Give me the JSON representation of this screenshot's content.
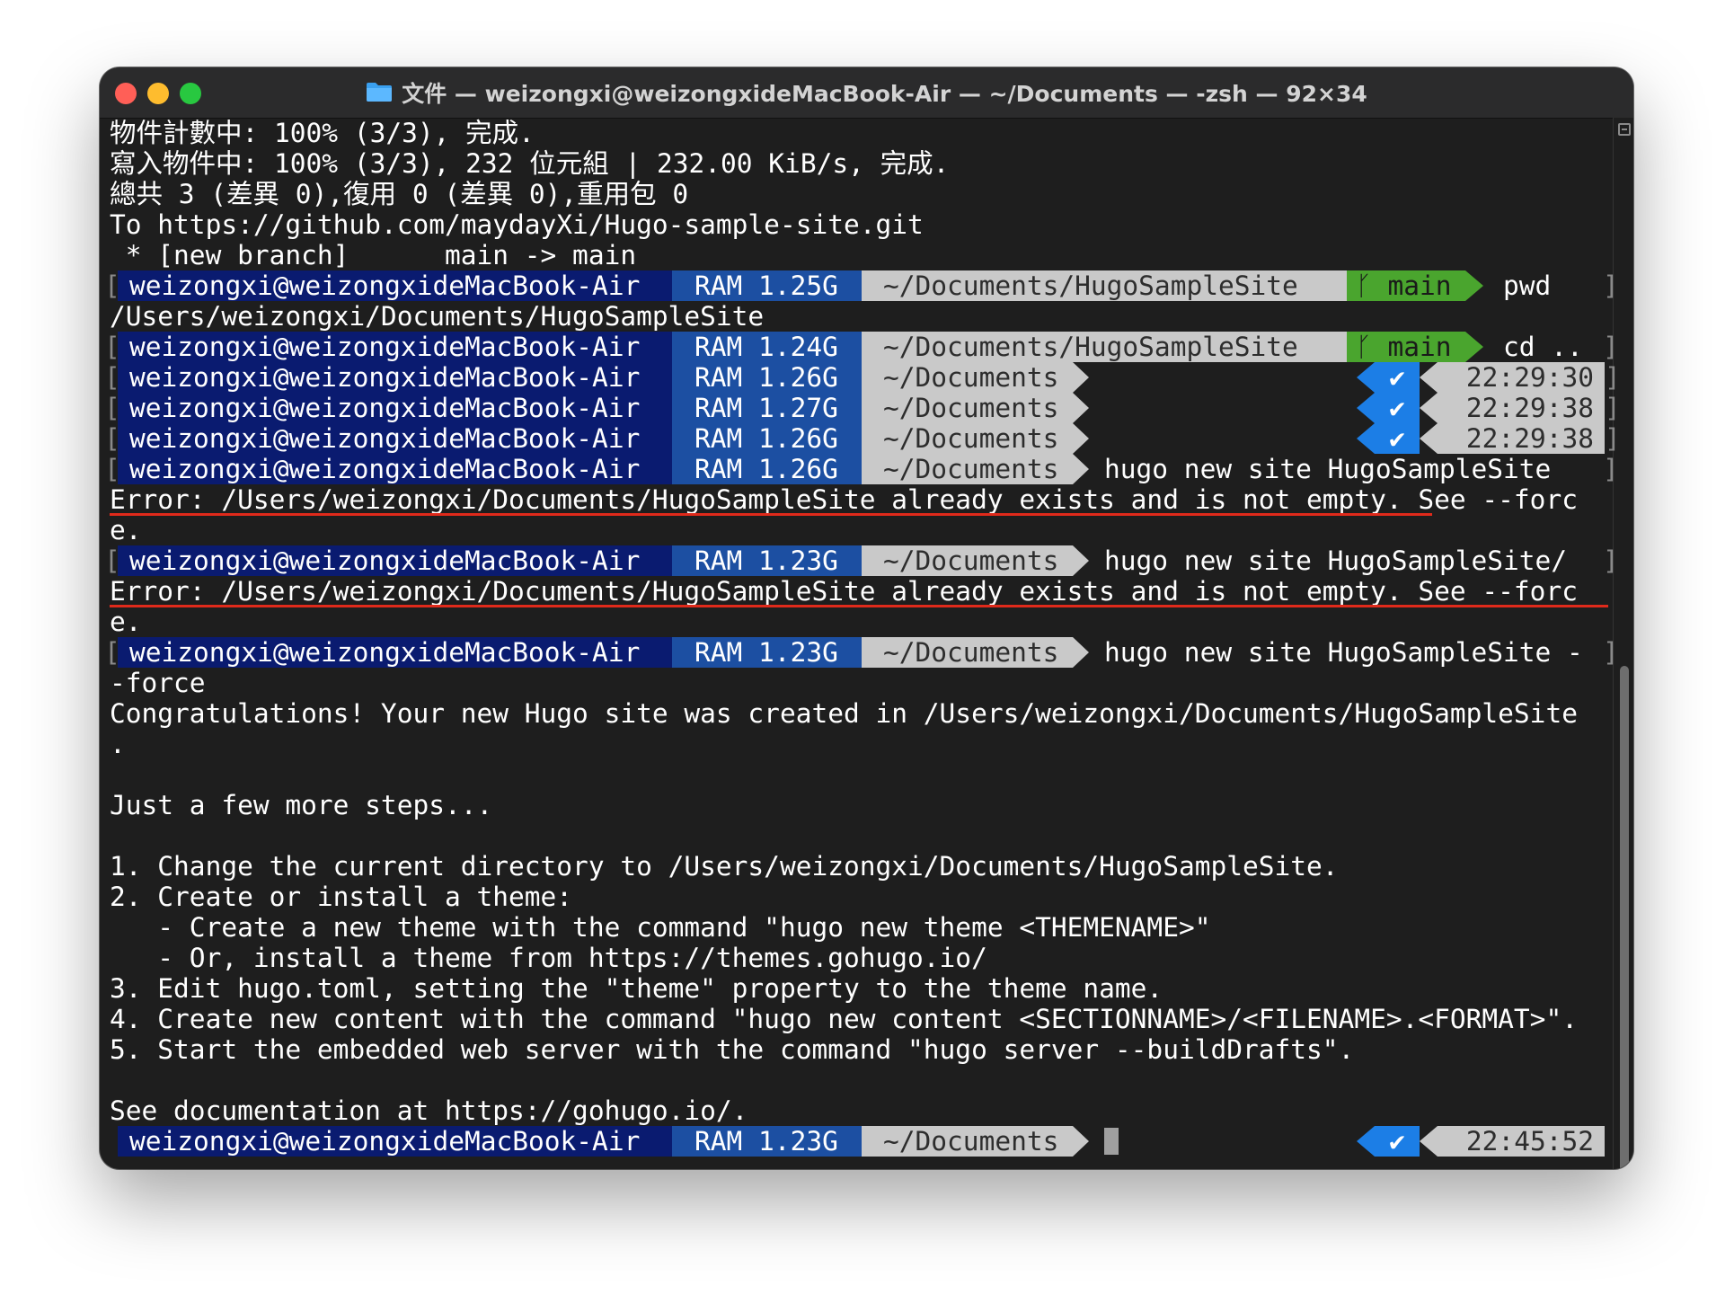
{
  "window": {
    "title": "文件 — weizongxi@weizongxideMacBook-Air — ~/Documents — -zsh — 92×34",
    "folder_icon": "folder-icon"
  },
  "lines": {
    "l1": "物件計數中: 100% (3/3), 完成.",
    "l2": "寫入物件中: 100% (3/3), 232 位元組 | 232.00 KiB/s, 完成.",
    "l3": "總共 3 (差異 0),復用 0 (差異 0),重用包 0",
    "l4": "To https://github.com/maydayXi/Hugo-sample-site.git",
    "l5": " * [new branch]      main -> main",
    "out_pwd": "/Users/weizongxi/Documents/HugoSampleSite",
    "err1a": "Error: /Users/weizongxi/Documents/HugoSampleSite already exists and is not empty. See --forc",
    "err1b": "e.",
    "err2a": "Error: /Users/weizongxi/Documents/HugoSampleSite already exists and is not empty. See --forc",
    "err2b": "e.",
    "force_wrap": "-force",
    "congrats": "Congratulations! Your new Hugo site was created in /Users/weizongxi/Documents/HugoSampleSite",
    "congrats_dot": ".",
    "steps_title": "Just a few more steps...",
    "step1": "1. Change the current directory to /Users/weizongxi/Documents/HugoSampleSite.",
    "step2": "2. Create or install a theme:",
    "step2a": "   - Create a new theme with the command \"hugo new theme <THEMENAME>\"",
    "step2b": "   - Or, install a theme from https://themes.gohugo.io/",
    "step3": "3. Edit hugo.toml, setting the \"theme\" property to the theme name.",
    "step4": "4. Create new content with the command \"hugo new content <SECTIONNAME>/<FILENAME>.<FORMAT>\".",
    "step5": "5. Start the embedded web server with the command \"hugo server --buildDrafts\".",
    "docs": "See documentation at https://gohugo.io/."
  },
  "prompts": {
    "user": "weizongxi@weizongxideMacBook-Air",
    "p1": {
      "ram": "RAM 1.25G",
      "path": "~/Documents/HugoSampleSite",
      "branch": "main",
      "cmd": "pwd"
    },
    "p2": {
      "ram": "RAM 1.24G",
      "path": "~/Documents/HugoSampleSite",
      "branch": "main",
      "cmd": "cd .."
    },
    "p3": {
      "ram": "RAM 1.26G",
      "path": "~/Documents",
      "check": "✔",
      "time": "22:29:30"
    },
    "p4": {
      "ram": "RAM 1.27G",
      "path": "~/Documents",
      "check": "✔",
      "time": "22:29:38"
    },
    "p5": {
      "ram": "RAM 1.26G",
      "path": "~/Documents",
      "check": "✔",
      "time": "22:29:38"
    },
    "p6": {
      "ram": "RAM 1.26G",
      "path": "~/Documents",
      "cmd": "hugo new site HugoSampleSite"
    },
    "p7": {
      "ram": "RAM 1.23G",
      "path": "~/Documents",
      "cmd": "hugo new site HugoSampleSite/"
    },
    "p8": {
      "ram": "RAM 1.23G",
      "path": "~/Documents",
      "cmd": "hugo new site HugoSampleSite -"
    },
    "p9": {
      "ram": "RAM 1.23G",
      "path": "~/Documents",
      "check": "✔",
      "time": "22:45:52"
    }
  },
  "colors": {
    "user_bg": "#0a1b70",
    "ram_bg": "#1c4fa2",
    "path_bg": "#c9c9c9",
    "git_bg": "#4aa52e",
    "ok_bg": "#1c7ee6",
    "error_underline": "#e02a1b"
  }
}
